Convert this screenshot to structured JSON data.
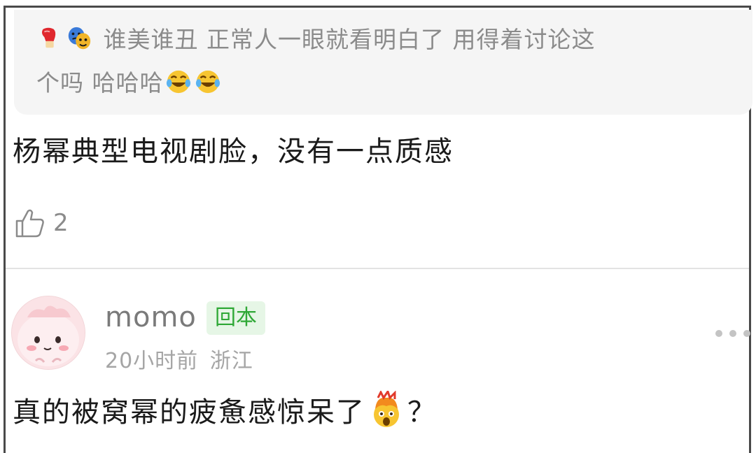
{
  "quoted_comment": {
    "text_line1": "谁美谁丑 正常人一眼就看明白了 用得着讨论这",
    "text_line2": "个吗 哈哈哈",
    "leading_icons": [
      "boxing-glove-icon",
      "performing-arts-icon"
    ],
    "trailing_icons": [
      "laughing-tears-icon",
      "laughing-tears-icon"
    ]
  },
  "comment": {
    "text": "杨幂典型电视剧脸，没有一点质感",
    "like_count": "2",
    "like_icon": "thumbs-up-icon"
  },
  "reply": {
    "username": "momo",
    "badge": "回本",
    "time": "20小时前",
    "location": "浙江",
    "text_before_emoji": "真的被窝幂的疲惫感惊呆了",
    "emoji": "exploding-head-icon",
    "text_after_emoji": "？"
  },
  "colors": {
    "badge_bg": "#e6f6e6",
    "badge_text": "#2fa836",
    "muted_text": "#8b8b8b",
    "quote_bg": "#f5f5f5"
  }
}
